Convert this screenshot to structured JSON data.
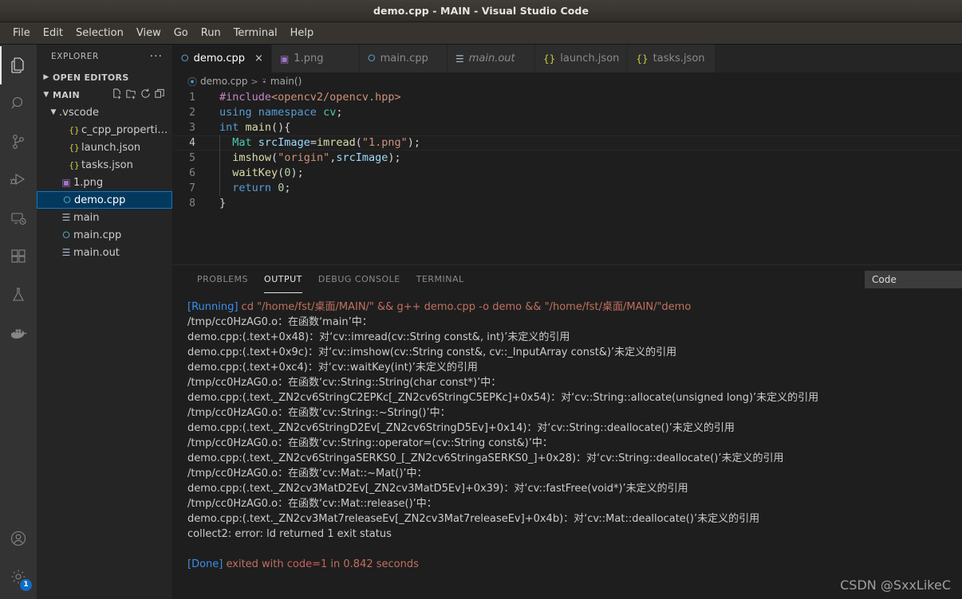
{
  "window": {
    "title": "demo.cpp - MAIN - Visual Studio Code"
  },
  "menubar": {
    "items": [
      "File",
      "Edit",
      "Selection",
      "View",
      "Go",
      "Run",
      "Terminal",
      "Help"
    ]
  },
  "activitybar": {
    "top": [
      {
        "name": "explorer-icon",
        "label": "Explorer",
        "active": true
      },
      {
        "name": "search-icon",
        "label": "Search",
        "active": false
      },
      {
        "name": "source-control-icon",
        "label": "Source Control",
        "active": false
      },
      {
        "name": "run-debug-icon",
        "label": "Run and Debug",
        "active": false
      },
      {
        "name": "remote-explorer-icon",
        "label": "Remote Explorer",
        "active": false
      },
      {
        "name": "extensions-icon",
        "label": "Extensions",
        "active": false
      },
      {
        "name": "testing-icon",
        "label": "Testing",
        "active": false
      },
      {
        "name": "docker-icon",
        "label": "Docker",
        "active": false
      }
    ],
    "bottom": [
      {
        "name": "account-icon",
        "label": "Accounts",
        "badge": ""
      },
      {
        "name": "settings-gear-icon",
        "label": "Manage",
        "badge": "1"
      }
    ]
  },
  "sidebar": {
    "title": "EXPLORER",
    "more_actions": "···",
    "sections": [
      {
        "label": "OPEN EDITORS",
        "expanded": false
      },
      {
        "label": "MAIN",
        "expanded": true,
        "actions": [
          "new-file-icon",
          "new-folder-icon",
          "refresh-icon",
          "collapse-all-icon"
        ]
      }
    ],
    "tree": [
      {
        "label": ".vscode",
        "indent": 1,
        "icon": "folder",
        "twisty": "v",
        "selected": false
      },
      {
        "label": "c_cpp_properties.js...",
        "indent": 2,
        "icon": "json",
        "twisty": "",
        "selected": false
      },
      {
        "label": "launch.json",
        "indent": 2,
        "icon": "json",
        "twisty": "",
        "selected": false
      },
      {
        "label": "tasks.json",
        "indent": 2,
        "icon": "json",
        "twisty": "",
        "selected": false
      },
      {
        "label": "1.png",
        "indent": 1,
        "icon": "image",
        "twisty": "",
        "selected": false
      },
      {
        "label": "demo.cpp",
        "indent": 1,
        "icon": "cpp",
        "twisty": "",
        "selected": true
      },
      {
        "label": "main",
        "indent": 1,
        "icon": "binary",
        "twisty": "",
        "selected": false
      },
      {
        "label": "main.cpp",
        "indent": 1,
        "icon": "cpp",
        "twisty": "",
        "selected": false
      },
      {
        "label": "main.out",
        "indent": 1,
        "icon": "binary",
        "twisty": "",
        "selected": false
      }
    ]
  },
  "tabs": [
    {
      "label": "demo.cpp",
      "icon": "cpp",
      "active": true,
      "italic": false,
      "closable": true,
      "close_glyph": "×"
    },
    {
      "label": "1.png",
      "icon": "image",
      "active": false,
      "italic": false,
      "closable": false
    },
    {
      "label": "main.cpp",
      "icon": "cpp",
      "active": false,
      "italic": false,
      "closable": false
    },
    {
      "label": "main.out",
      "icon": "binary",
      "active": false,
      "italic": true,
      "closable": false
    },
    {
      "label": "launch.json",
      "icon": "json",
      "active": false,
      "italic": false,
      "closable": false
    },
    {
      "label": "tasks.json",
      "icon": "json",
      "active": false,
      "italic": false,
      "closable": false
    }
  ],
  "breadcrumb": {
    "file": "demo.cpp",
    "separator": ">",
    "symbol": "main()"
  },
  "editor": {
    "language": "cpp",
    "current_line": 4,
    "lines": [
      {
        "n": "1",
        "tokens": [
          {
            "t": "#include",
            "c": "pre"
          },
          {
            "t": "<opencv2/opencv.hpp>",
            "c": "str"
          }
        ]
      },
      {
        "n": "2",
        "tokens": [
          {
            "t": "using",
            "c": "kw"
          },
          {
            "t": " ",
            "c": "plain"
          },
          {
            "t": "namespace",
            "c": "kw"
          },
          {
            "t": " ",
            "c": "plain"
          },
          {
            "t": "cv",
            "c": "type"
          },
          {
            "t": ";",
            "c": "plain"
          }
        ]
      },
      {
        "n": "3",
        "tokens": [
          {
            "t": "int",
            "c": "kw"
          },
          {
            "t": " ",
            "c": "plain"
          },
          {
            "t": "main",
            "c": "fn"
          },
          {
            "t": "(){",
            "c": "plain"
          }
        ]
      },
      {
        "n": "4",
        "tokens": [
          {
            "t": "  ",
            "c": "plain"
          },
          {
            "t": "Mat",
            "c": "type"
          },
          {
            "t": " ",
            "c": "plain"
          },
          {
            "t": "srcImage",
            "c": "var"
          },
          {
            "t": "=",
            "c": "op"
          },
          {
            "t": "imread",
            "c": "fn"
          },
          {
            "t": "(",
            "c": "plain"
          },
          {
            "t": "\"1.png\"",
            "c": "str"
          },
          {
            "t": ");",
            "c": "plain"
          }
        ]
      },
      {
        "n": "5",
        "tokens": [
          {
            "t": "  ",
            "c": "plain"
          },
          {
            "t": "imshow",
            "c": "fn"
          },
          {
            "t": "(",
            "c": "plain"
          },
          {
            "t": "\"origin\"",
            "c": "str"
          },
          {
            "t": ",",
            "c": "plain"
          },
          {
            "t": "srcImage",
            "c": "var"
          },
          {
            "t": ");",
            "c": "plain"
          }
        ]
      },
      {
        "n": "6",
        "tokens": [
          {
            "t": "  ",
            "c": "plain"
          },
          {
            "t": "waitKey",
            "c": "fn"
          },
          {
            "t": "(",
            "c": "plain"
          },
          {
            "t": "0",
            "c": "num"
          },
          {
            "t": ");",
            "c": "plain"
          }
        ]
      },
      {
        "n": "7",
        "tokens": [
          {
            "t": "  ",
            "c": "plain"
          },
          {
            "t": "return",
            "c": "kw"
          },
          {
            "t": " ",
            "c": "plain"
          },
          {
            "t": "0",
            "c": "num"
          },
          {
            "t": ";",
            "c": "plain"
          }
        ]
      },
      {
        "n": "8",
        "tokens": [
          {
            "t": "}",
            "c": "plain"
          }
        ]
      }
    ]
  },
  "panel": {
    "tabs": [
      {
        "label": "PROBLEMS",
        "active": false
      },
      {
        "label": "OUTPUT",
        "active": true
      },
      {
        "label": "DEBUG CONSOLE",
        "active": false
      },
      {
        "label": "TERMINAL",
        "active": false
      }
    ],
    "output_channel": "Code",
    "output_lines": [
      {
        "parts": [
          {
            "t": "[Running]",
            "c": "blue"
          },
          {
            "t": " cd \"/home/fst/桌面/MAIN/\" && g++ demo.cpp -o demo && \"/home/fst/桌面/MAIN/\"demo",
            "c": "salmon"
          }
        ]
      },
      {
        "parts": [
          {
            "t": "/tmp/cc0HzAG0.o：在函数‘main’中：",
            "c": "norm"
          }
        ]
      },
      {
        "parts": [
          {
            "t": "demo.cpp:(.text+0x48)：对‘cv::imread(cv::String const&, int)’未定义的引用",
            "c": "norm"
          }
        ]
      },
      {
        "parts": [
          {
            "t": "demo.cpp:(.text+0x9c)：对‘cv::imshow(cv::String const&, cv::_InputArray const&)’未定义的引用",
            "c": "norm"
          }
        ]
      },
      {
        "parts": [
          {
            "t": "demo.cpp:(.text+0xc4)：对‘cv::waitKey(int)’未定义的引用",
            "c": "norm"
          }
        ]
      },
      {
        "parts": [
          {
            "t": "/tmp/cc0HzAG0.o：在函数‘cv::String::String(char const*)’中：",
            "c": "norm"
          }
        ]
      },
      {
        "parts": [
          {
            "t": "demo.cpp:(.text._ZN2cv6StringC2EPKc[_ZN2cv6StringC5EPKc]+0x54)：对‘cv::String::allocate(unsigned long)’未定义的引用",
            "c": "norm"
          }
        ]
      },
      {
        "parts": [
          {
            "t": "/tmp/cc0HzAG0.o：在函数‘cv::String::~String()’中：",
            "c": "norm"
          }
        ]
      },
      {
        "parts": [
          {
            "t": "demo.cpp:(.text._ZN2cv6StringD2Ev[_ZN2cv6StringD5Ev]+0x14)：对‘cv::String::deallocate()’未定义的引用",
            "c": "norm"
          }
        ]
      },
      {
        "parts": [
          {
            "t": "/tmp/cc0HzAG0.o：在函数‘cv::String::operator=(cv::String const&)’中：",
            "c": "norm"
          }
        ]
      },
      {
        "parts": [
          {
            "t": "demo.cpp:(.text._ZN2cv6StringaSERKS0_[_ZN2cv6StringaSERKS0_]+0x28)：对‘cv::String::deallocate()’未定义的引用",
            "c": "norm"
          }
        ]
      },
      {
        "parts": [
          {
            "t": "/tmp/cc0HzAG0.o：在函数‘cv::Mat::~Mat()’中：",
            "c": "norm"
          }
        ]
      },
      {
        "parts": [
          {
            "t": "demo.cpp:(.text._ZN2cv3MatD2Ev[_ZN2cv3MatD5Ev]+0x39)：对‘cv::fastFree(void*)’未定义的引用",
            "c": "norm"
          }
        ]
      },
      {
        "parts": [
          {
            "t": "/tmp/cc0HzAG0.o：在函数‘cv::Mat::release()’中：",
            "c": "norm"
          }
        ]
      },
      {
        "parts": [
          {
            "t": "demo.cpp:(.text._ZN2cv3Mat7releaseEv[_ZN2cv3Mat7releaseEv]+0x4b)：对‘cv::Mat::deallocate()’未定义的引用",
            "c": "norm"
          }
        ]
      },
      {
        "parts": [
          {
            "t": "collect2: error: ld returned 1 exit status",
            "c": "norm"
          }
        ]
      },
      {
        "parts": [
          {
            "t": "",
            "c": "norm"
          }
        ]
      },
      {
        "parts": [
          {
            "t": "[Done]",
            "c": "blue"
          },
          {
            "t": " exited with ",
            "c": "salmon"
          },
          {
            "t": "code=1",
            "c": "red"
          },
          {
            "t": " in 0.842 seconds",
            "c": "salmon"
          }
        ]
      }
    ]
  },
  "watermark": "CSDN @SxxLikeC",
  "colors": {
    "accent": "#0a7aca",
    "selected_bg": "#04395e",
    "editor_bg": "#1e1e1e",
    "sidebar_bg": "#252526",
    "activitybar_bg": "#333333",
    "titlebar_bg": "#38352f",
    "badge_bg": "#0e6cc4"
  }
}
